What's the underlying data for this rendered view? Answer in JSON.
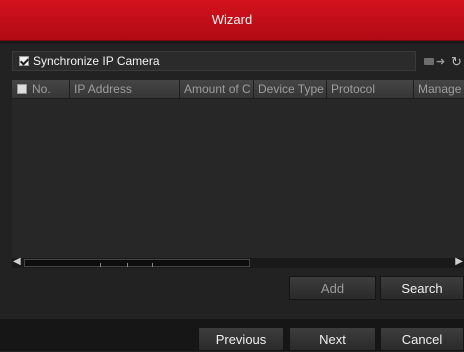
{
  "window": {
    "title": "Wizard"
  },
  "sync": {
    "label": "Synchronize IP Camera",
    "checked": true
  },
  "toolbar_icons": [
    "network-icon",
    "arrow-right-icon",
    "refresh-icon"
  ],
  "table": {
    "columns": [
      "No.",
      "IP Address",
      "Amount of C",
      "Device Type",
      "Protocol",
      "Manage"
    ],
    "rows": []
  },
  "buttons": {
    "add": "Add",
    "search": "Search",
    "previous": "Previous",
    "next": "Next",
    "cancel": "Cancel"
  },
  "colors": {
    "title_bar": "#c40f1a",
    "background": "#222222"
  }
}
